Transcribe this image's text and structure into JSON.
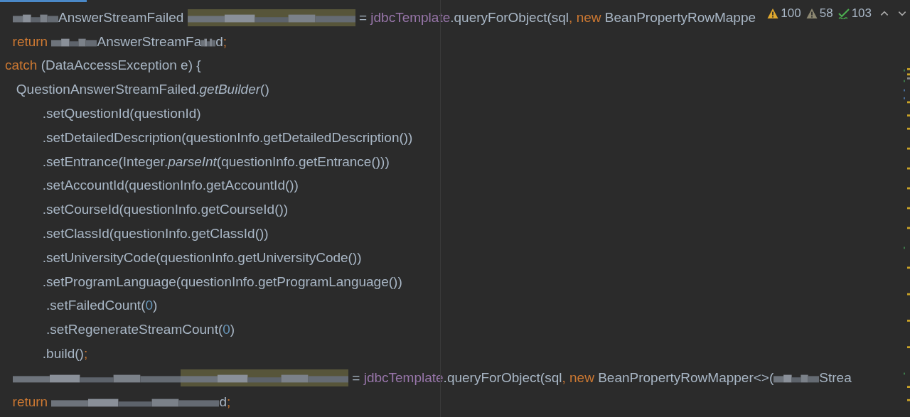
{
  "inspections": [
    {
      "kind": "warning",
      "count": "100"
    },
    {
      "kind": "weak-warning",
      "count": "58"
    },
    {
      "kind": "typo",
      "count": "103"
    }
  ],
  "code_lines": [
    {
      "segments": [
        {
          "kind": "redacted-medium"
        },
        {
          "kind": "text",
          "text": "AnswerStreamFailed "
        },
        {
          "kind": "highlight-redacted"
        },
        {
          "kind": "text",
          "text": " = "
        },
        {
          "kind": "field",
          "text": "jdbcTemplate"
        },
        {
          "kind": "text",
          "text": ".queryForObject(sql"
        },
        {
          "kind": "keyword",
          "text": ", new "
        },
        {
          "kind": "text",
          "text": "BeanPropertyRowMappe"
        }
      ]
    },
    {
      "segments": [
        {
          "kind": "keyword",
          "text": "  return "
        },
        {
          "kind": "redacted-medium"
        },
        {
          "kind": "text",
          "text": "AnswerStreamFa"
        },
        {
          "kind": "redacted-small"
        },
        {
          "kind": "text",
          "text": "d"
        },
        {
          "kind": "keyword",
          "text": ";"
        }
      ]
    },
    {
      "segments": [
        {
          "kind": "keyword",
          "text": "catch "
        },
        {
          "kind": "text",
          "text": "(DataAccessException e) {"
        }
      ]
    },
    {
      "segments": [
        {
          "kind": "text",
          "text": "   QuestionAnswerStreamFailed."
        },
        {
          "kind": "italic",
          "text": "getBuilder"
        },
        {
          "kind": "text",
          "text": "()"
        }
      ]
    },
    {
      "segments": [
        {
          "kind": "text",
          "text": "          .setQuestionId(questionId)"
        }
      ]
    },
    {
      "segments": [
        {
          "kind": "text",
          "text": "          .setDetailedDescription(questionInfo.getDetailedDescription())"
        }
      ]
    },
    {
      "segments": [
        {
          "kind": "text",
          "text": "          .setEntrance(Integer."
        },
        {
          "kind": "italic",
          "text": "parseInt"
        },
        {
          "kind": "text",
          "text": "(questionInfo.getEntrance()))"
        }
      ]
    },
    {
      "segments": [
        {
          "kind": "text",
          "text": "          .setAccountId(questionInfo.getAccountId())"
        }
      ]
    },
    {
      "segments": [
        {
          "kind": "text",
          "text": "          .setCourseId(questionInfo.getCourseId())"
        }
      ]
    },
    {
      "segments": [
        {
          "kind": "text",
          "text": "          .setClassId(questionInfo.getClassId())"
        }
      ]
    },
    {
      "segments": [
        {
          "kind": "text",
          "text": "          .setUniversityCode(questionInfo.getUniversityCode())"
        }
      ]
    },
    {
      "segments": [
        {
          "kind": "text",
          "text": "          .setProgramLanguage(questionInfo.getProgramLanguage())"
        }
      ]
    },
    {
      "segments": [
        {
          "kind": "text",
          "text": "           .setFailedCount("
        },
        {
          "kind": "number",
          "text": "0"
        },
        {
          "kind": "text",
          "text": ")"
        }
      ]
    },
    {
      "segments": [
        {
          "kind": "text",
          "text": "           .setRegenerateStreamCount("
        },
        {
          "kind": "number",
          "text": "0"
        },
        {
          "kind": "text",
          "text": ")"
        }
      ]
    },
    {
      "segments": [
        {
          "kind": "text",
          "text": "          .build()"
        },
        {
          "kind": "keyword",
          "text": ";"
        }
      ]
    },
    {
      "segments": [
        {
          "kind": "redacted-long"
        },
        {
          "kind": "highlight-redacted"
        },
        {
          "kind": "text",
          "text": " = "
        },
        {
          "kind": "field",
          "text": "jdbcTemplate"
        },
        {
          "kind": "text",
          "text": ".queryForObject(sql"
        },
        {
          "kind": "keyword",
          "text": ", new "
        },
        {
          "kind": "text",
          "text": "BeanPropertyRowMapper<>("
        },
        {
          "kind": "redacted-medium"
        },
        {
          "kind": "text",
          "text": "Strea"
        }
      ]
    },
    {
      "segments": [
        {
          "kind": "keyword",
          "text": "  return "
        },
        {
          "kind": "redacted-long"
        },
        {
          "kind": "text",
          "text": "d"
        },
        {
          "kind": "keyword",
          "text": ";"
        }
      ]
    }
  ]
}
